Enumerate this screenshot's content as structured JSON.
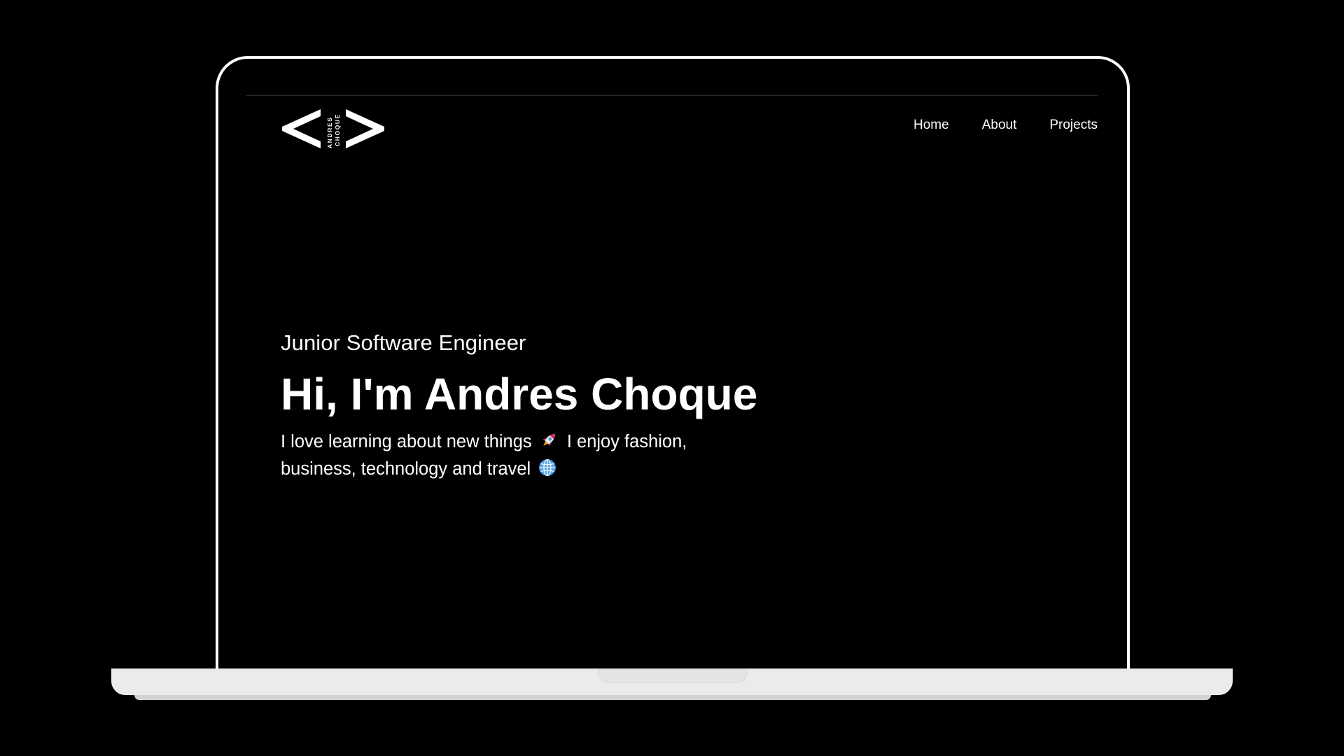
{
  "logo": {
    "text_line1": "ANDRES",
    "text_line2": "CHOQUE",
    "color": "#ffffff"
  },
  "nav": {
    "items": [
      {
        "label": "Home"
      },
      {
        "label": "About"
      },
      {
        "label": "Projects"
      }
    ]
  },
  "hero": {
    "subtitle": "Junior Software Engineer",
    "title": "Hi, I'm Andres Choque",
    "desc_part1": "I love learning about new things",
    "desc_part2": "I enjoy fashion, business, technology and travel",
    "icons": [
      "rocket-icon",
      "globe-icon"
    ]
  },
  "colors": {
    "background": "#000000",
    "text": "#ffffff",
    "frame": "#ffffff",
    "laptop_base": "#ebebeb"
  }
}
